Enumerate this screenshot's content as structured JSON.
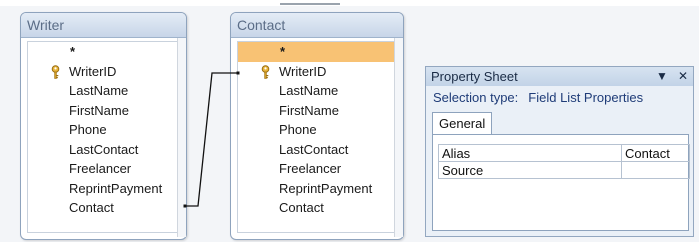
{
  "tables": [
    {
      "title": "Writer",
      "fields": [
        "*",
        "WriterID",
        "LastName",
        "FirstName",
        "Phone",
        "LastContact",
        "Freelancer",
        "ReprintPayment",
        "Contact"
      ],
      "key_field": "WriterID"
    },
    {
      "title": "Contact",
      "fields": [
        "*",
        "WriterID",
        "LastName",
        "FirstName",
        "Phone",
        "LastContact",
        "Freelancer",
        "ReprintPayment",
        "Contact"
      ],
      "key_field": "WriterID",
      "selected_field": "*"
    }
  ],
  "property_sheet": {
    "title": "Property Sheet",
    "selection_label": "Selection type:",
    "selection_value": "Field List Properties",
    "tab": "General",
    "rows": [
      {
        "name": "Alias",
        "value": "Contact"
      },
      {
        "name": "Source",
        "value": ""
      }
    ],
    "controls": [
      "dropdown-icon",
      "close-icon"
    ]
  },
  "colors": {
    "selected_row": "#f8c274",
    "titlebar": "#c7d5e8",
    "canvas": "#f3f5f8"
  }
}
